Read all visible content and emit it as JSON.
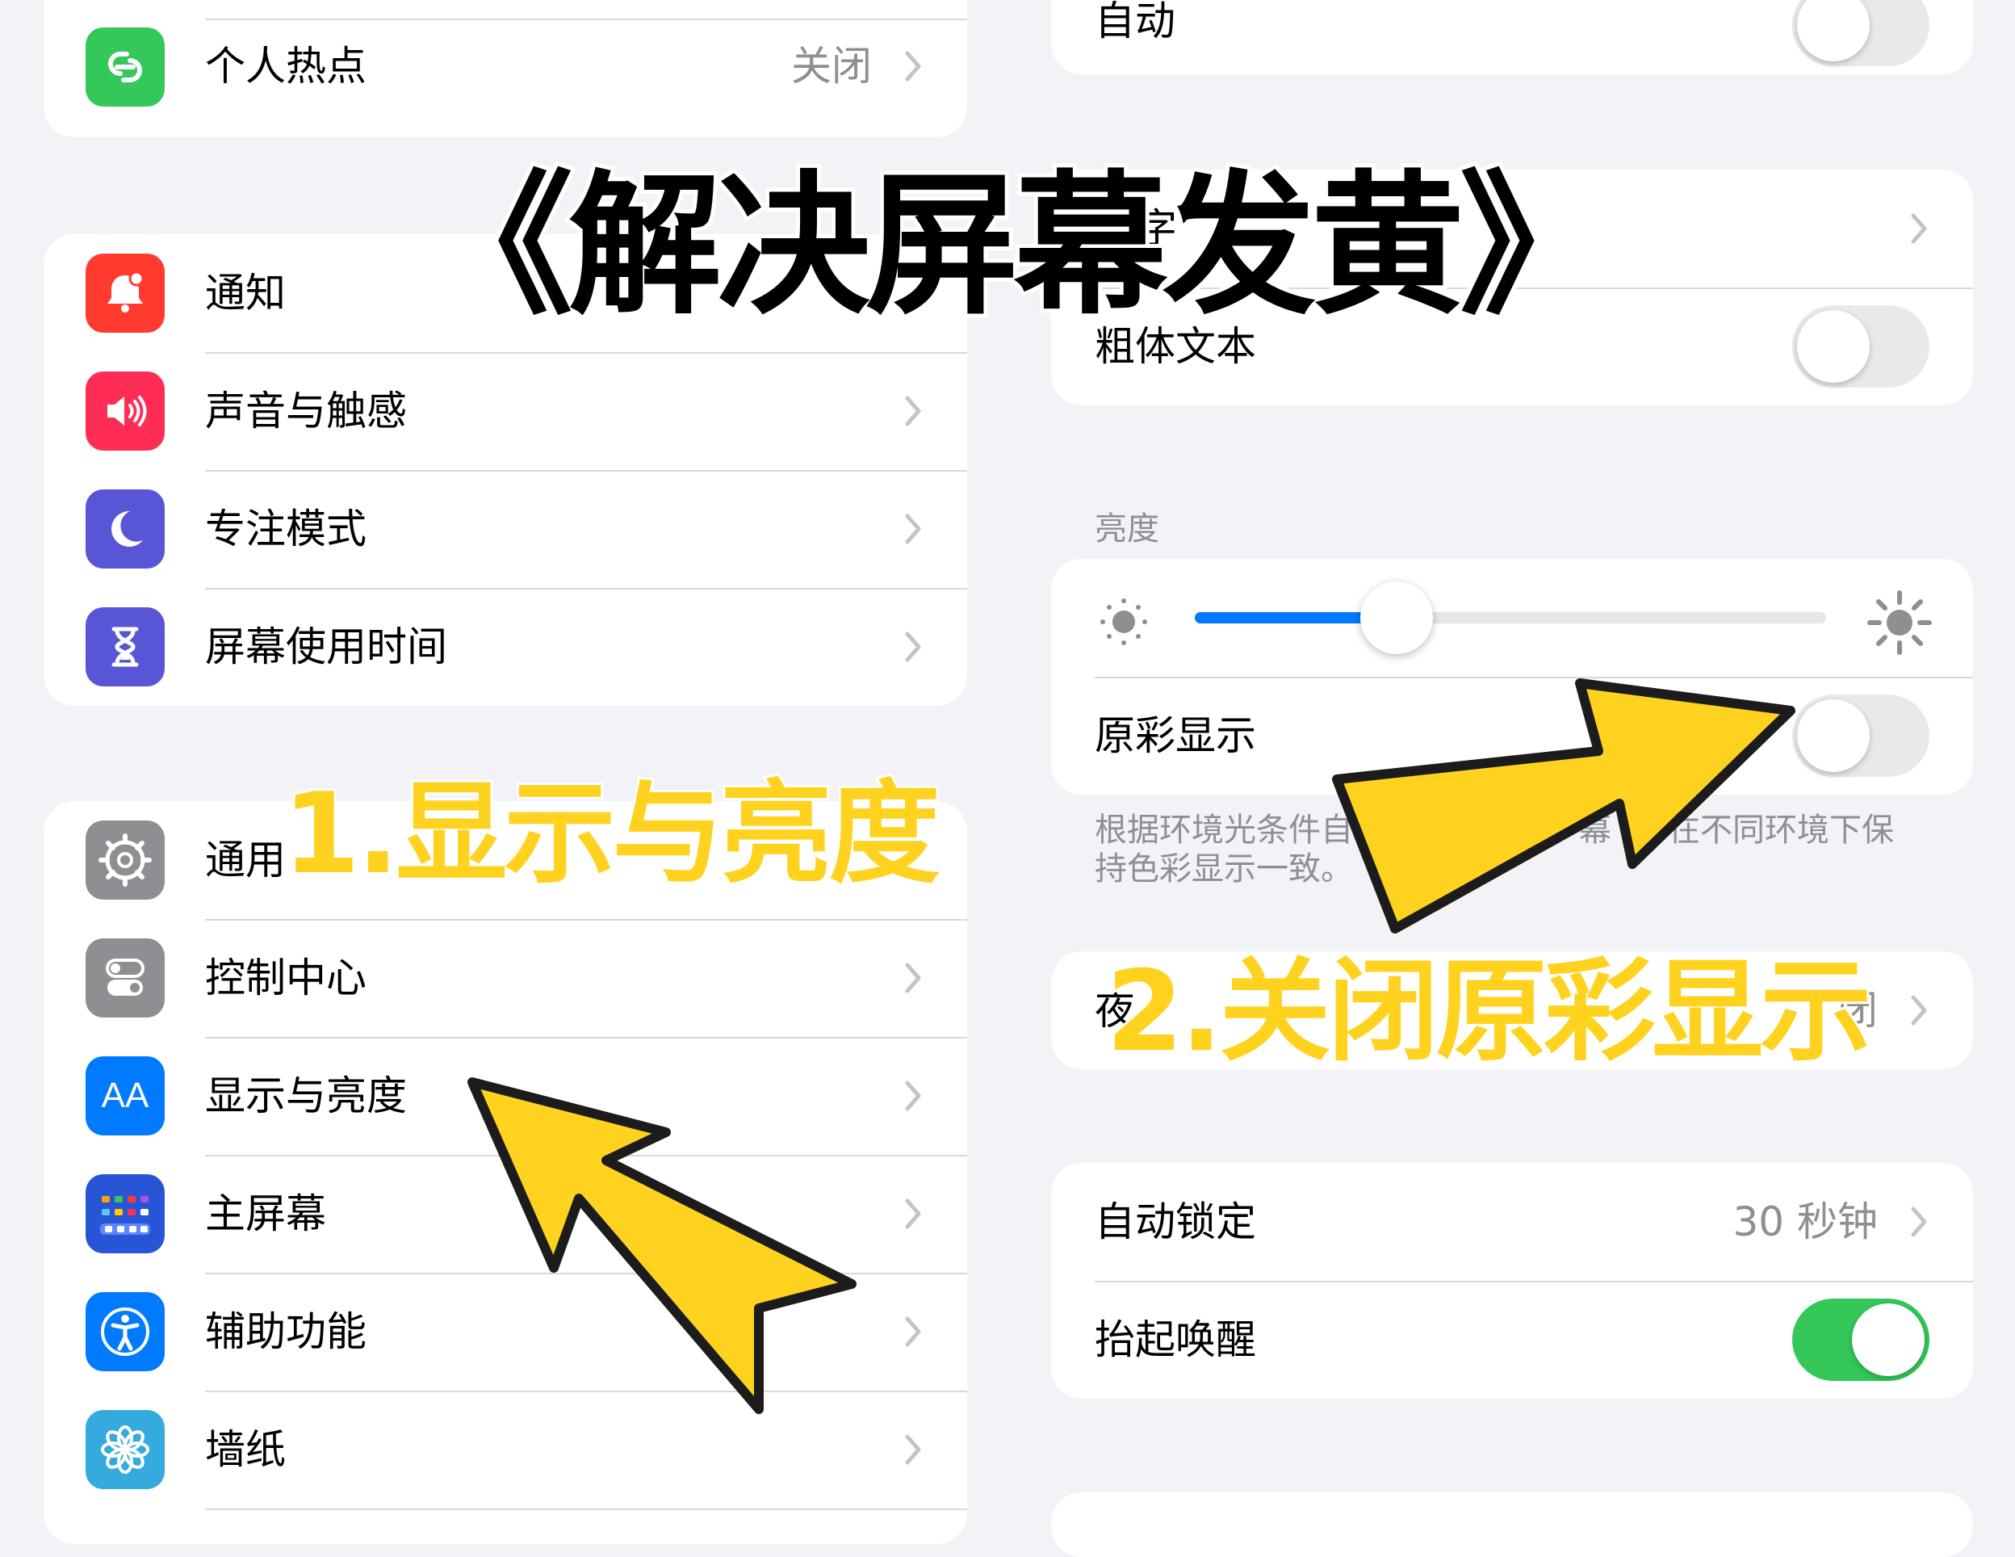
{
  "left": {
    "top_group": {
      "hotspot": {
        "label": "个人热点",
        "value": "关闭",
        "icon": "link-icon",
        "color": "#34c759"
      }
    },
    "group2": [
      {
        "label": "通知",
        "icon": "bell-icon",
        "color": "#ff3b30"
      },
      {
        "label": "声音与触感",
        "icon": "speaker-icon",
        "color": "#ff2d55"
      },
      {
        "label": "专注模式",
        "icon": "moon-icon",
        "color": "#5856d6"
      },
      {
        "label": "屏幕使用时间",
        "icon": "hourglass-icon",
        "color": "#5856d6"
      }
    ],
    "group3": [
      {
        "label": "通用",
        "icon": "gear-icon",
        "color": "#8e8e93"
      },
      {
        "label": "控制中心",
        "icon": "switches-icon",
        "color": "#8e8e93"
      },
      {
        "label": "显示与亮度",
        "icon": "aa-icon",
        "glyph": "AA",
        "color": "#007aff"
      },
      {
        "label": "主屏幕",
        "icon": "home-grid-icon",
        "color": "#2755d6"
      },
      {
        "label": "辅助功能",
        "icon": "accessibility-icon",
        "color": "#007aff"
      },
      {
        "label": "墙纸",
        "icon": "flower-icon",
        "color": "#35aadc"
      }
    ]
  },
  "right": {
    "top_group": {
      "label": "自动",
      "toggle": false
    },
    "text_group": {
      "text_size_label_partial": "字",
      "bold_label": "粗体文本",
      "bold_toggle": false
    },
    "brightness": {
      "header": "亮度",
      "level": 0.32,
      "true_tone_label": "原彩显示",
      "true_tone_toggle": false,
      "footnote_line1": "根据环境光条件自动调",
      "footnote_line1_tail": "幕",
      "footnote_line1_end": "在不同环境下保",
      "footnote_line2": "持色彩显示一致。"
    },
    "night_shift": {
      "label_partial": "夜",
      "value_partial": "闭"
    },
    "lock_group": {
      "auto_lock_label": "自动锁定",
      "auto_lock_value": "30 秒钟",
      "raise_label": "抬起唤醒",
      "raise_toggle": true
    }
  },
  "overlay": {
    "title": "《解决屏幕发黄》",
    "step1": "1.显示与亮度",
    "step2": "2.关闭原彩显示"
  },
  "colors": {
    "arrow_fill": "#ffd21f",
    "slider_fill": "#007aff",
    "toggle_on": "#34c759"
  }
}
